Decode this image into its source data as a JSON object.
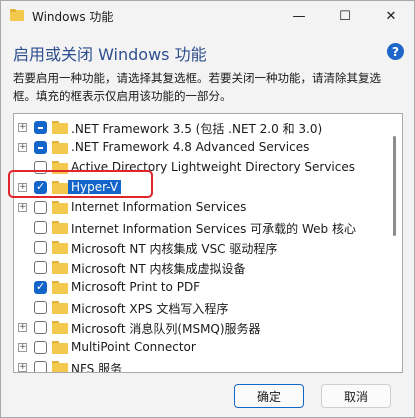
{
  "window": {
    "title": "Windows 功能"
  },
  "controls": {
    "minimize": "—",
    "maximize": "☐",
    "close": "✕"
  },
  "heading": "启用或关闭 Windows 功能",
  "help_label": "?",
  "description": {
    "line1": "若要启用一种功能，请选择其复选框。若要关闭一种功能，请清除其复选",
    "line2": "框。填充的框表示仅启用该功能的一部分。"
  },
  "features": [
    {
      "label": ".NET Framework 3.5 (包括 .NET 2.0 和 3.0)",
      "expander": "+",
      "state": "partial"
    },
    {
      "label": ".NET Framework 4.8 Advanced Services",
      "expander": "+",
      "state": "partial"
    },
    {
      "label": "Active Directory Lightweight Directory Services",
      "expander": "",
      "state": "unchecked"
    },
    {
      "label": "Hyper-V",
      "expander": "+",
      "state": "checked"
    },
    {
      "label": "Internet Information Services",
      "expander": "+",
      "state": "unchecked"
    },
    {
      "label": "Internet Information Services 可承载的 Web 核心",
      "expander": "",
      "state": "unchecked"
    },
    {
      "label": "Microsoft NT 内核集成 VSC 驱动程序",
      "expander": "",
      "state": "unchecked"
    },
    {
      "label": "Microsoft NT 内核集成虚拟设备",
      "expander": "",
      "state": "unchecked"
    },
    {
      "label": "Microsoft Print to PDF",
      "expander": "",
      "state": "checked"
    },
    {
      "label": "Microsoft XPS 文档写入程序",
      "expander": "",
      "state": "unchecked"
    },
    {
      "label": "Microsoft 消息队列(MSMQ)服务器",
      "expander": "+",
      "state": "unchecked"
    },
    {
      "label": "MultiPoint Connector",
      "expander": "+",
      "state": "unchecked"
    },
    {
      "label": "NFS 服务",
      "expander": "+",
      "state": "unchecked"
    }
  ],
  "buttons": {
    "ok": "确定",
    "cancel": "取消"
  },
  "colors": {
    "accent": "#1465c9",
    "highlight": "#e0262b",
    "heading": "#2f4f8f",
    "folder": "#f2c94c"
  }
}
